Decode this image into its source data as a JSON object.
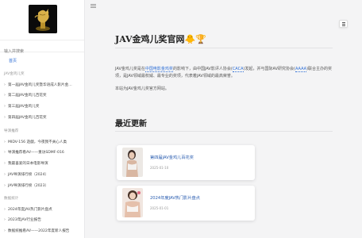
{
  "sidebar": {
    "search_placeholder": "输入并搜索",
    "home": "首页",
    "sections": [
      {
        "title": "JAV金鸡儿奖",
        "items": [
          "第一届JAV金鸡儿奖暨华语成人影片金…",
          "第二届JAV金鸡儿百花奖",
          "第三届JAV金鸡儿奖",
          "第四届JAV金鸡儿百花奖"
        ]
      },
      {
        "title": "导演推荐",
        "items": [
          "MIDV-156 遊戯，今夜我不关心人类",
          "导演推荐看AV——重访SDMF-016",
          "我最喜爱的日本电影导演",
          "JAV导演排行榜（2024）",
          "JAV导演排行榜（2023）"
        ]
      },
      {
        "title": "数据统计",
        "items": [
          "2024年度JAV热门影片盘点",
          "2023年JAV行业报告",
          "数据统推看AV——2022年度新人报告"
        ]
      }
    ]
  },
  "main": {
    "title": "JAV金鸡儿奖官网🐥🏆",
    "para1_a": "JAV金鸡儿奖是在",
    "para1_link1": "中国电影金鸡奖",
    "para1_b": "的影响下，由中国JAV影评人协会(",
    "para1_link2": "CACA",
    "para1_c": ")发起，并与国际AV研究协会(",
    "para1_link3": "AAAA",
    "para1_d": ")联合主办的奖项，是JAV领域最权威、最专业的奖项，代表着JAV领域的最高荣誉。",
    "para2": "本站为JAV金鸡儿奖官方网站。",
    "recent_heading": "最近更新",
    "cards": [
      {
        "title": "第四届JAV金鸡儿百花奖",
        "date": "2025-01-10"
      },
      {
        "title": "2024年度JAV热门影片盘点",
        "date": "2025-01-01"
      }
    ]
  },
  "icons": {
    "menu": "hamburger-menu-icon",
    "logo": "golden-rooster-trophy-logo",
    "toc": "list-icon"
  },
  "colors": {
    "link": "#2f6fd6",
    "card_title": "#2a5db0",
    "background": "#f4f4f5"
  }
}
